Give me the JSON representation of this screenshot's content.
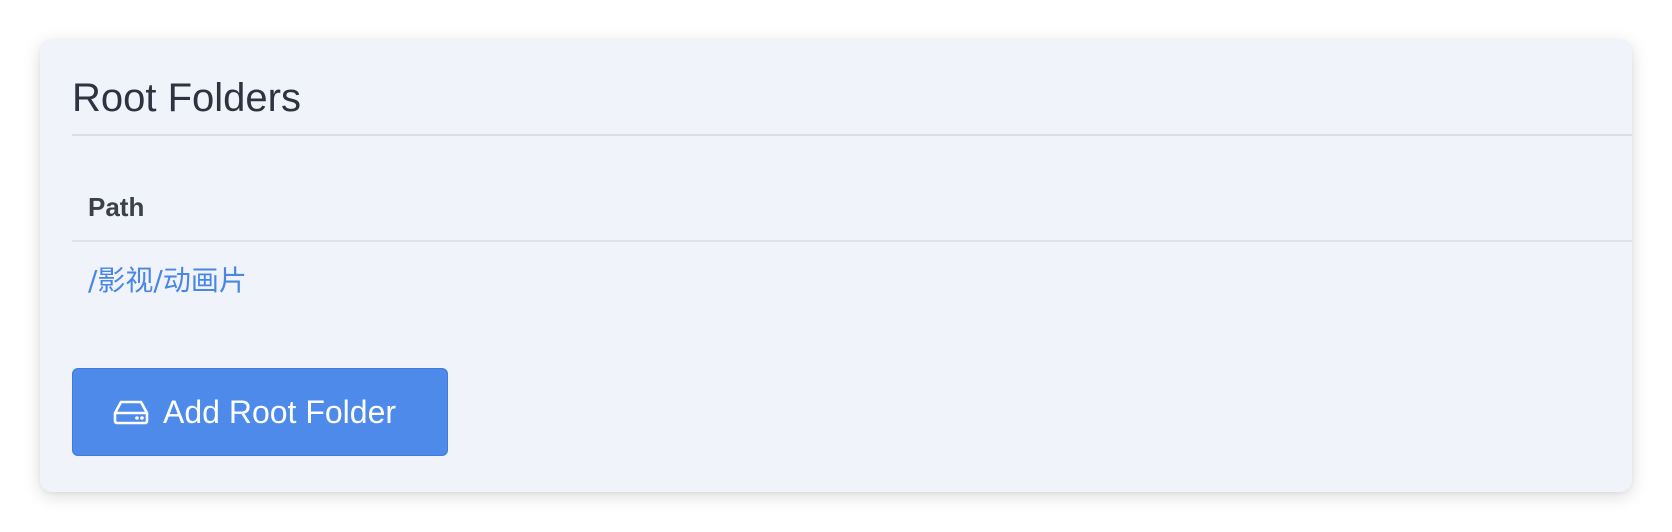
{
  "section": {
    "title": "Root Folders"
  },
  "table": {
    "columns": [
      "Path"
    ],
    "rows": [
      {
        "path": "/影视/动画片"
      }
    ]
  },
  "add_button": {
    "label": "Add Root Folder",
    "icon": "hard-drive-icon"
  },
  "colors": {
    "card_background": "#f0f3f9",
    "accent": "#4d8aea",
    "link": "#4a87e5",
    "title_text": "#2d3340"
  }
}
